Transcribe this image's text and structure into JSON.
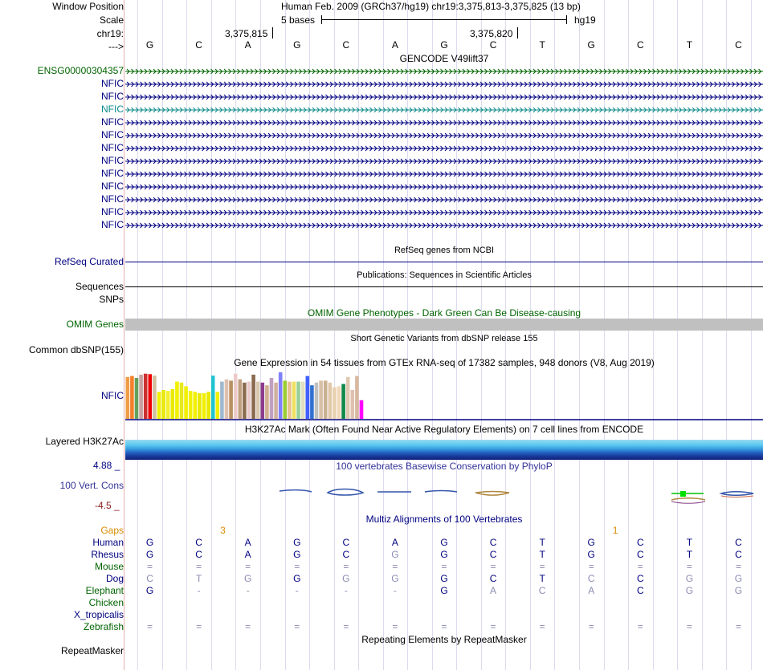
{
  "header": {
    "window_position_label": "Window Position",
    "scale_label": "Scale",
    "chrom_label": "chr19:",
    "strand_label": "--->",
    "position_title": "Human Feb. 2009 (GRCh37/hg19)   chr19:3,375,813-3,375,825 (13 bp)",
    "scale_text": "5 bases",
    "assembly": "hg19",
    "tick1": "3,375,815",
    "tick2": "3,375,820",
    "bases": [
      "G",
      "C",
      "A",
      "G",
      "C",
      "A",
      "G",
      "C",
      "T",
      "G",
      "C",
      "T",
      "C"
    ]
  },
  "gencode": {
    "title": "GENCODE V49lift37",
    "tracks": [
      {
        "name": "ENSG00000304357",
        "color": "#006400"
      },
      {
        "name": "NFIC",
        "color": "#000080"
      },
      {
        "name": "NFIC",
        "color": "#000080"
      },
      {
        "name": "NFIC",
        "color": "#0c8a8a"
      },
      {
        "name": "NFIC",
        "color": "#000080"
      },
      {
        "name": "NFIC",
        "color": "#000080"
      },
      {
        "name": "NFIC",
        "color": "#000080"
      },
      {
        "name": "NFIC",
        "color": "#000080"
      },
      {
        "name": "NFIC",
        "color": "#000080"
      },
      {
        "name": "NFIC",
        "color": "#000080"
      },
      {
        "name": "NFIC",
        "color": "#000080"
      },
      {
        "name": "NFIC",
        "color": "#000080"
      },
      {
        "name": "NFIC",
        "color": "#000080"
      }
    ]
  },
  "refseq": {
    "label": "RefSeq Curated",
    "title": "RefSeq genes from NCBI"
  },
  "publications": {
    "label": "Sequences",
    "title": "Publications: Sequences in Scientific Articles"
  },
  "snps": {
    "label": "SNPs"
  },
  "omim": {
    "label": "OMIM Genes",
    "title": "OMIM Gene Phenotypes - Dark Green Can Be Disease-causing",
    "color": "#006400"
  },
  "dbsnp": {
    "label": "Common dbSNP(155)",
    "title": "Short Genetic Variants from dbSNP release 155"
  },
  "gtex": {
    "label": "NFIC",
    "title": "Gene Expression in 54 tissues from GTEx RNA-seq of 17382 samples, 948 donors (V8, Aug 2019)",
    "levels": [
      0.9,
      0.92,
      0.88,
      0.95,
      0.97,
      0.96,
      0.93,
      0.58,
      0.62,
      0.6,
      0.64,
      0.8,
      0.78,
      0.7,
      0.6,
      0.58,
      0.55,
      0.55,
      0.58,
      0.93,
      0.58,
      0.8,
      0.85,
      0.82,
      0.97,
      0.85,
      0.78,
      0.8,
      0.95,
      0.8,
      0.78,
      0.72,
      0.88,
      0.78,
      1.0,
      0.82,
      0.8,
      0.8,
      0.8,
      0.8,
      0.92,
      0.72,
      0.78,
      0.82,
      0.82,
      0.78,
      0.68,
      0.7,
      0.75,
      0.9,
      0.62,
      0.92,
      0.4
    ],
    "colors": [
      "#ef9c45",
      "#f47f2a",
      "#64a05a",
      "#c8a0a0",
      "#cc3030",
      "#f20000",
      "#d0c0a0",
      "#f0f000",
      "#e8e80a",
      "#f0f030",
      "#e8e800",
      "#f0f000",
      "#e8e820",
      "#f0f000",
      "#f0f000",
      "#f0f000",
      "#e8e800",
      "#f0f000",
      "#e8e800",
      "#20c4d0",
      "#f0f000",
      "#a0b8d0",
      "#e0c0b0",
      "#b89060",
      "#eccaca",
      "#c0a080",
      "#8c6c50",
      "#e8c8c8",
      "#8a6a4e",
      "#d8c8b0",
      "#8c3c8c",
      "#d0b090",
      "#c0a0c0",
      "#d0b0a0",
      "#8080ff",
      "#9acd32",
      "#e8c090",
      "#f0e060",
      "#98d098",
      "#e0e0c0",
      "#4060ff",
      "#3070d0",
      "#c0c0c0",
      "#d8c0a8",
      "#c8b090",
      "#e0c8a8",
      "#e8d0b0",
      "#f0d8b8",
      "#108848",
      "#e0c8b0",
      "#e0c0b0",
      "#d8b8a0",
      "#ff00ff"
    ]
  },
  "h3k27ac": {
    "label": "Layered H3K27Ac",
    "title": "H3K27Ac Mark (Often Found Near Active Regulatory Elements) on 7 cell lines from ENCODE"
  },
  "phylop": {
    "label": "100 Vert. Cons",
    "title": "100 vertebrates Basewise Conservation by PhyloP",
    "ymax": "4.88 _",
    "ymin": "-4.5 _"
  },
  "multiz": {
    "title": "Multiz Alignments of 100 Vertebrates",
    "gaps_label": "Gaps",
    "gaps": [
      {
        "after_base": 1,
        "value": "3"
      },
      {
        "after_base": 9,
        "value": "1"
      }
    ],
    "species": [
      {
        "name": "Human",
        "color": "#000080",
        "bases": [
          "G",
          "C",
          "A",
          "G",
          "C",
          "A",
          "G",
          "C",
          "T",
          "G",
          "C",
          "T",
          "C"
        ],
        "bright": [
          1,
          1,
          1,
          1,
          1,
          1,
          1,
          1,
          1,
          1,
          1,
          1,
          1
        ]
      },
      {
        "name": "Rhesus",
        "color": "#000080",
        "bases": [
          "G",
          "C",
          "A",
          "G",
          "C",
          "G",
          "G",
          "C",
          "T",
          "G",
          "C",
          "T",
          "C"
        ],
        "bright": [
          1,
          1,
          1,
          1,
          1,
          0,
          1,
          1,
          1,
          1,
          1,
          1,
          1
        ]
      },
      {
        "name": "Mouse",
        "color": "#006400",
        "bases": [
          "=",
          "=",
          "=",
          "=",
          "=",
          "=",
          "=",
          "=",
          "=",
          "=",
          "=",
          "=",
          "="
        ],
        "bright": [
          0,
          0,
          0,
          0,
          0,
          0,
          0,
          0,
          0,
          0,
          0,
          0,
          0
        ]
      },
      {
        "name": "Dog",
        "color": "#000080",
        "bases": [
          "C",
          "T",
          "G",
          "G",
          "G",
          "G",
          "G",
          "C",
          "T",
          "C",
          "C",
          "G",
          "G"
        ],
        "bright": [
          0,
          0,
          0,
          1,
          0,
          0,
          1,
          1,
          1,
          0,
          1,
          0,
          0
        ]
      },
      {
        "name": "Elephant",
        "color": "#006400",
        "bases": [
          "G",
          "-",
          "-",
          "-",
          "-",
          "-",
          "G",
          "A",
          "C",
          "A",
          "C",
          "G",
          "G"
        ],
        "bright": [
          1,
          0,
          0,
          0,
          0,
          0,
          1,
          0,
          0,
          0,
          1,
          0,
          0
        ]
      },
      {
        "name": "Chicken",
        "color": "#006400",
        "bases": [
          "",
          "",
          "",
          "",
          "",
          "",
          "",
          "",
          "",
          "",
          "",
          "",
          ""
        ],
        "bright": [
          0,
          0,
          0,
          0,
          0,
          0,
          0,
          0,
          0,
          0,
          0,
          0,
          0
        ]
      },
      {
        "name": "X_tropicalis",
        "color": "#000080",
        "bases": [
          "",
          "",
          "",
          "",
          "",
          "",
          "",
          "",
          "",
          "",
          "",
          "",
          ""
        ],
        "bright": [
          0,
          0,
          0,
          0,
          0,
          0,
          0,
          0,
          0,
          0,
          0,
          0,
          0
        ]
      },
      {
        "name": "Zebrafish",
        "color": "#006400",
        "bases": [
          "=",
          "=",
          "=",
          "=",
          "=",
          "=",
          "=",
          "=",
          "=",
          "=",
          "=",
          "=",
          "="
        ],
        "bright": [
          0,
          0,
          0,
          0,
          0,
          0,
          0,
          0,
          0,
          0,
          0,
          0,
          0
        ]
      }
    ]
  },
  "repeatmasker": {
    "label": "RepeatMasker",
    "title": "Repeating Elements by RepeatMasker"
  }
}
